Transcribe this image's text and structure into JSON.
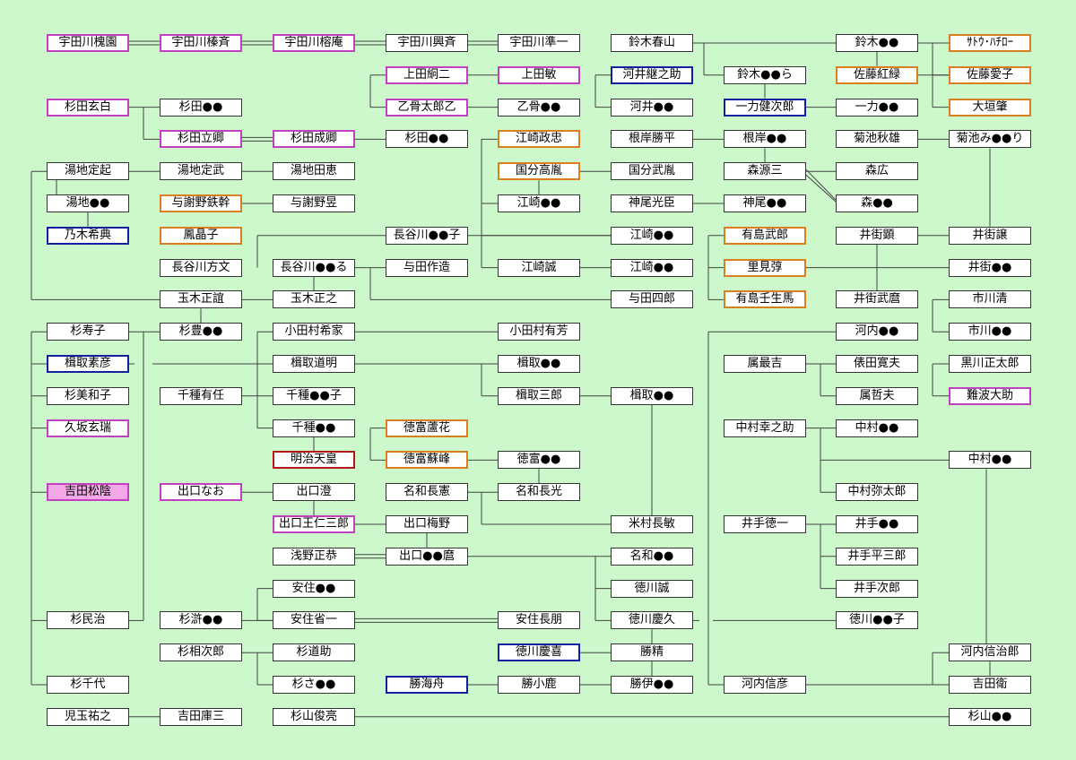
{
  "nodes": [
    {
      "id": "a1",
      "label": "宇田川槐園",
      "style": "pink"
    },
    {
      "id": "a2",
      "label": "宇田川榛斉",
      "style": "pink"
    },
    {
      "id": "a3",
      "label": "宇田川榕庵",
      "style": "pink"
    },
    {
      "id": "a4",
      "label": "宇田川興斉",
      "style": "plain"
    },
    {
      "id": "a5",
      "label": "宇田川準一",
      "style": "plain"
    },
    {
      "id": "a6",
      "label": "鈴木春山",
      "style": "plain"
    },
    {
      "id": "a7",
      "label": "鈴木●●",
      "style": "plain"
    },
    {
      "id": "a8",
      "label": "ｻﾄｳ･ﾊﾁﾛｰ",
      "style": "orange"
    },
    {
      "id": "b1",
      "label": "上田絅二",
      "style": "pink"
    },
    {
      "id": "b2",
      "label": "上田敏",
      "style": "pink"
    },
    {
      "id": "b3",
      "label": "河井継之助",
      "style": "blue"
    },
    {
      "id": "b4",
      "label": "鈴木●●ら",
      "style": "plain"
    },
    {
      "id": "b5",
      "label": "佐藤紅緑",
      "style": "orange"
    },
    {
      "id": "b6",
      "label": "佐藤愛子",
      "style": "orange"
    },
    {
      "id": "c0",
      "label": "杉田玄白",
      "style": "pink"
    },
    {
      "id": "c1",
      "label": "杉田●●",
      "style": "plain"
    },
    {
      "id": "c2",
      "label": "乙骨太郎乙",
      "style": "pink"
    },
    {
      "id": "c3",
      "label": "乙骨●●",
      "style": "plain"
    },
    {
      "id": "c4",
      "label": "河井●●",
      "style": "plain"
    },
    {
      "id": "c5",
      "label": "一力健次郎",
      "style": "blue"
    },
    {
      "id": "c6",
      "label": "一力●●",
      "style": "plain"
    },
    {
      "id": "c7",
      "label": "大垣肇",
      "style": "orange"
    },
    {
      "id": "d1",
      "label": "杉田立卿",
      "style": "pink"
    },
    {
      "id": "d2",
      "label": "杉田成卿",
      "style": "pink"
    },
    {
      "id": "d3",
      "label": "杉田●●",
      "style": "plain"
    },
    {
      "id": "d4",
      "label": "江崎政忠",
      "style": "orange"
    },
    {
      "id": "d5",
      "label": "根岸勝平",
      "style": "plain"
    },
    {
      "id": "d6",
      "label": "根岸●●",
      "style": "plain"
    },
    {
      "id": "d7",
      "label": "菊池秋雄",
      "style": "plain"
    },
    {
      "id": "d8",
      "label": "菊池み●●り",
      "style": "plain"
    },
    {
      "id": "e0",
      "label": "湯地定起",
      "style": "plain"
    },
    {
      "id": "e1",
      "label": "湯地定武",
      "style": "plain"
    },
    {
      "id": "e2",
      "label": "湯地田恵",
      "style": "plain"
    },
    {
      "id": "e3",
      "label": "国分高胤",
      "style": "orange"
    },
    {
      "id": "e4",
      "label": "国分武胤",
      "style": "plain"
    },
    {
      "id": "e5",
      "label": "森源三",
      "style": "plain"
    },
    {
      "id": "e6",
      "label": "森広",
      "style": "plain"
    },
    {
      "id": "f0",
      "label": "湯地●●",
      "style": "plain"
    },
    {
      "id": "f1",
      "label": "与謝野鉄幹",
      "style": "orange"
    },
    {
      "id": "f2",
      "label": "与謝野昱",
      "style": "plain"
    },
    {
      "id": "f3",
      "label": "江崎●●",
      "style": "plain"
    },
    {
      "id": "f4",
      "label": "神尾光臣",
      "style": "plain"
    },
    {
      "id": "f5",
      "label": "神尾●●",
      "style": "plain"
    },
    {
      "id": "f6",
      "label": "森●●",
      "style": "plain"
    },
    {
      "id": "g0",
      "label": "乃木希典",
      "style": "blue"
    },
    {
      "id": "g1",
      "label": "鳳晶子",
      "style": "orange"
    },
    {
      "id": "g2",
      "label": "長谷川●●子",
      "style": "plain"
    },
    {
      "id": "g3",
      "label": "江崎●●",
      "style": "plain"
    },
    {
      "id": "g4",
      "label": "有島武郎",
      "style": "orange"
    },
    {
      "id": "g5",
      "label": "井街顕",
      "style": "plain"
    },
    {
      "id": "g6",
      "label": "井街譲",
      "style": "plain"
    },
    {
      "id": "h1",
      "label": "長谷川方文",
      "style": "plain"
    },
    {
      "id": "h2",
      "label": "長谷川●●る",
      "style": "plain"
    },
    {
      "id": "h3",
      "label": "与田作造",
      "style": "plain"
    },
    {
      "id": "h4",
      "label": "江崎誠",
      "style": "plain"
    },
    {
      "id": "h5",
      "label": "江崎●●",
      "style": "plain"
    },
    {
      "id": "h6",
      "label": "里見弴",
      "style": "orange"
    },
    {
      "id": "h7",
      "label": "井街●●",
      "style": "plain"
    },
    {
      "id": "i1",
      "label": "玉木正誼",
      "style": "plain"
    },
    {
      "id": "i2",
      "label": "玉木正之",
      "style": "plain"
    },
    {
      "id": "i3",
      "label": "与田四郎",
      "style": "plain"
    },
    {
      "id": "i4",
      "label": "有島壬生馬",
      "style": "orange"
    },
    {
      "id": "i5",
      "label": "井街武麿",
      "style": "plain"
    },
    {
      "id": "i6",
      "label": "市川清",
      "style": "plain"
    },
    {
      "id": "j0",
      "label": "杉寿子",
      "style": "plain"
    },
    {
      "id": "j1",
      "label": "杉豊●●",
      "style": "plain"
    },
    {
      "id": "j2",
      "label": "小田村希家",
      "style": "plain"
    },
    {
      "id": "j3",
      "label": "小田村有芳",
      "style": "plain"
    },
    {
      "id": "j4",
      "label": "河内●●",
      "style": "plain"
    },
    {
      "id": "j5",
      "label": "市川●●",
      "style": "plain"
    },
    {
      "id": "k0",
      "label": "楫取素彦",
      "style": "blue"
    },
    {
      "id": "k1",
      "label": "楫取道明",
      "style": "plain"
    },
    {
      "id": "k2",
      "label": "楫取●●",
      "style": "plain"
    },
    {
      "id": "k3",
      "label": "属最吉",
      "style": "plain"
    },
    {
      "id": "k4",
      "label": "俵田寛夫",
      "style": "plain"
    },
    {
      "id": "k5",
      "label": "黒川正太郎",
      "style": "plain"
    },
    {
      "id": "l0",
      "label": "杉美和子",
      "style": "plain"
    },
    {
      "id": "l1",
      "label": "千種有任",
      "style": "plain"
    },
    {
      "id": "l2",
      "label": "千種●●子",
      "style": "plain"
    },
    {
      "id": "l3",
      "label": "楫取三郎",
      "style": "plain"
    },
    {
      "id": "l4",
      "label": "楫取●●",
      "style": "plain"
    },
    {
      "id": "l5",
      "label": "属哲夫",
      "style": "plain"
    },
    {
      "id": "l6",
      "label": "難波大助",
      "style": "pink"
    },
    {
      "id": "m0",
      "label": "久坂玄瑞",
      "style": "pink"
    },
    {
      "id": "m1",
      "label": "千種●●",
      "style": "plain"
    },
    {
      "id": "m2",
      "label": "徳富蘆花",
      "style": "orange"
    },
    {
      "id": "m3",
      "label": "中村幸之助",
      "style": "plain"
    },
    {
      "id": "m4",
      "label": "中村●●",
      "style": "plain"
    },
    {
      "id": "n1",
      "label": "明治天皇",
      "style": "red"
    },
    {
      "id": "n2",
      "label": "徳富蘇峰",
      "style": "orange"
    },
    {
      "id": "n3",
      "label": "徳富●●",
      "style": "plain"
    },
    {
      "id": "n4",
      "label": "中村●●",
      "style": "plain"
    },
    {
      "id": "o0",
      "label": "吉田松陰",
      "style": "pinkfill"
    },
    {
      "id": "o1",
      "label": "出口なお",
      "style": "pink"
    },
    {
      "id": "o2",
      "label": "出口澄",
      "style": "plain"
    },
    {
      "id": "o3",
      "label": "名和長憲",
      "style": "plain"
    },
    {
      "id": "o4",
      "label": "名和長光",
      "style": "plain"
    },
    {
      "id": "o5",
      "label": "中村弥太郎",
      "style": "plain"
    },
    {
      "id": "p1",
      "label": "出口王仁三郎",
      "style": "pink"
    },
    {
      "id": "p2",
      "label": "出口梅野",
      "style": "plain"
    },
    {
      "id": "p3",
      "label": "米村長敏",
      "style": "plain"
    },
    {
      "id": "p4",
      "label": "井手徳一",
      "style": "plain"
    },
    {
      "id": "p5",
      "label": "井手●●",
      "style": "plain"
    },
    {
      "id": "q1",
      "label": "浅野正恭",
      "style": "plain"
    },
    {
      "id": "q2",
      "label": "出口●●麿",
      "style": "plain"
    },
    {
      "id": "q3",
      "label": "名和●●",
      "style": "plain"
    },
    {
      "id": "q4",
      "label": "井手平三郎",
      "style": "plain"
    },
    {
      "id": "r1",
      "label": "安住●●",
      "style": "plain"
    },
    {
      "id": "r2",
      "label": "徳川誠",
      "style": "plain"
    },
    {
      "id": "r3",
      "label": "井手次郎",
      "style": "plain"
    },
    {
      "id": "s0",
      "label": "杉民治",
      "style": "plain"
    },
    {
      "id": "s1",
      "label": "杉滸●●",
      "style": "plain"
    },
    {
      "id": "s2",
      "label": "安住省一",
      "style": "plain"
    },
    {
      "id": "s3",
      "label": "安住長朋",
      "style": "plain"
    },
    {
      "id": "s4",
      "label": "徳川慶久",
      "style": "plain"
    },
    {
      "id": "s5",
      "label": "徳川●●子",
      "style": "plain"
    },
    {
      "id": "t1",
      "label": "杉相次郎",
      "style": "plain"
    },
    {
      "id": "t2",
      "label": "杉道助",
      "style": "plain"
    },
    {
      "id": "t3",
      "label": "徳川慶喜",
      "style": "blue"
    },
    {
      "id": "t4",
      "label": "勝精",
      "style": "plain"
    },
    {
      "id": "t5",
      "label": "河内信治郎",
      "style": "plain"
    },
    {
      "id": "u0",
      "label": "杉千代",
      "style": "plain"
    },
    {
      "id": "u1",
      "label": "杉さ●●",
      "style": "plain"
    },
    {
      "id": "u2",
      "label": "勝海舟",
      "style": "blue"
    },
    {
      "id": "u3",
      "label": "勝小鹿",
      "style": "plain"
    },
    {
      "id": "u4",
      "label": "勝伊●●",
      "style": "plain"
    },
    {
      "id": "u5",
      "label": "河内信彦",
      "style": "plain"
    },
    {
      "id": "u6",
      "label": "吉田衛",
      "style": "plain"
    },
    {
      "id": "v0",
      "label": "児玉祐之",
      "style": "plain"
    },
    {
      "id": "v1",
      "label": "吉田庫三",
      "style": "plain"
    },
    {
      "id": "v2",
      "label": "杉山俊亮",
      "style": "plain"
    },
    {
      "id": "v3",
      "label": "杉山●●",
      "style": "plain"
    }
  ]
}
